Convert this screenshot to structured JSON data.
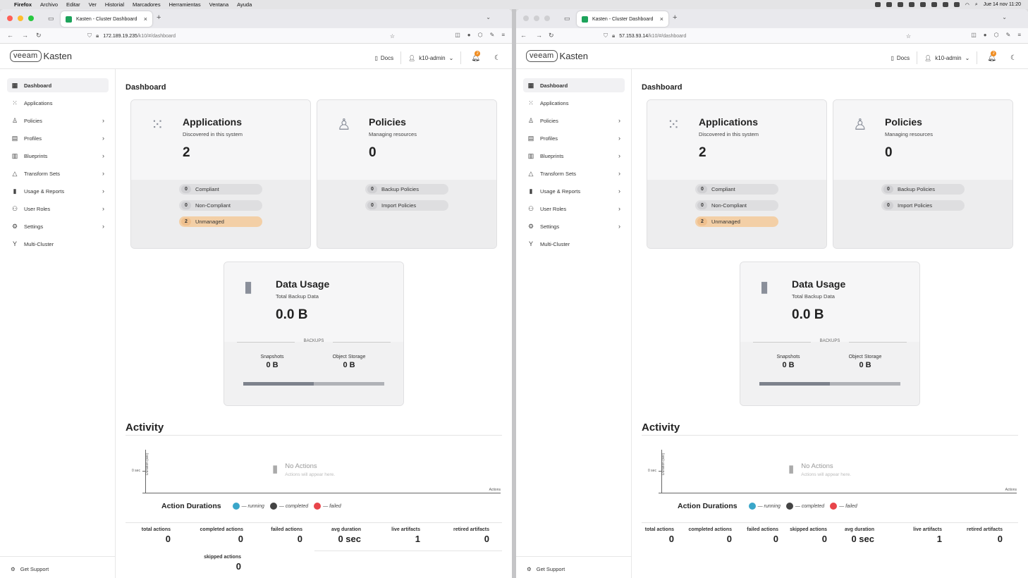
{
  "menubar": {
    "apple": "",
    "items": [
      "Firefox",
      "Archivo",
      "Editar",
      "Ver",
      "Historial",
      "Marcadores",
      "Herramientas",
      "Ventana",
      "Ayuda"
    ],
    "clock": "Jue 14 nov 11:20"
  },
  "browser1": {
    "tab_title": "Kasten - Cluster Dashboard",
    "url_host": "172.189.19.235",
    "url_path": "/k10/#/dashboard"
  },
  "browser2": {
    "tab_title": "Kasten - Cluster Dashboard",
    "url_host": "57.153.93.14",
    "url_path": "/k10/#/dashboard"
  },
  "header": {
    "logo_box": "veeam",
    "logo_text": "Kasten",
    "docs": "Docs",
    "user": "k10-admin",
    "notifications": "2"
  },
  "sidebar": {
    "items": [
      {
        "label": "Dashboard",
        "icon": "dashboard-icon"
      },
      {
        "label": "Applications",
        "icon": "grid-icon"
      },
      {
        "label": "Policies",
        "icon": "award-icon"
      },
      {
        "label": "Profiles",
        "icon": "doc-icon"
      },
      {
        "label": "Blueprints",
        "icon": "map-icon"
      },
      {
        "label": "Transform Sets",
        "icon": "shapes-icon"
      },
      {
        "label": "Usage & Reports",
        "icon": "chart-icon"
      },
      {
        "label": "User Roles",
        "icon": "users-icon"
      },
      {
        "label": "Settings",
        "icon": "gear-icon"
      },
      {
        "label": "Multi-Cluster",
        "icon": "fork-icon"
      }
    ],
    "support": "Get Support"
  },
  "dashboard": {
    "title": "Dashboard",
    "applications": {
      "title": "Applications",
      "subtitle": "Discovered in this system",
      "value": "2",
      "pills": [
        {
          "count": "0",
          "label": "Compliant"
        },
        {
          "count": "0",
          "label": "Non-Compliant"
        },
        {
          "count": "2",
          "label": "Unmanaged"
        }
      ]
    },
    "policies": {
      "title": "Policies",
      "subtitle": "Managing resources",
      "value": "0",
      "pills": [
        {
          "count": "0",
          "label": "Backup Policies"
        },
        {
          "count": "0",
          "label": "Import Policies"
        }
      ]
    },
    "data_usage": {
      "title": "Data Usage",
      "subtitle": "Total Backup Data",
      "value": "0.0 B",
      "backups_label": "BACKUPS",
      "snapshots_label": "Snapshots",
      "snapshots_value": "0 B",
      "object_storage_label": "Object Storage",
      "object_storage_value": "0 B",
      "bar_fill_fraction": 0.5
    }
  },
  "activity": {
    "title": "Activity",
    "y_axis_label": "Duration (sec)",
    "y_tick": "0 sec",
    "x_axis_label": "Actions",
    "empty_title": "No Actions",
    "empty_sub": "Actions will appear here.",
    "legend_title": "Action Durations",
    "legend": [
      {
        "label": "— running",
        "color": "#3aa6c9"
      },
      {
        "label": "— completed",
        "color": "#444444"
      },
      {
        "label": "— failed",
        "color": "#e8454a"
      }
    ]
  },
  "stats1": [
    {
      "label": "total actions",
      "value": "0"
    },
    {
      "label": "completed actions",
      "value": "0"
    },
    {
      "label": "failed actions",
      "value": "0"
    },
    {
      "label": "avg duration",
      "value": "0 sec"
    },
    {
      "label": "live artifacts",
      "value": "1"
    },
    {
      "label": "retired artifacts",
      "value": "0"
    },
    {
      "label": "skipped actions",
      "value": "0"
    }
  ],
  "stats2": [
    {
      "label": "total actions",
      "value": "0"
    },
    {
      "label": "completed actions",
      "value": "0"
    },
    {
      "label": "failed actions",
      "value": "0"
    },
    {
      "label": "skipped actions",
      "value": "0"
    },
    {
      "label": "avg duration",
      "value": "0 sec"
    },
    {
      "label": "live artifacts",
      "value": "1"
    },
    {
      "label": "retired artifacts",
      "value": "0"
    }
  ]
}
